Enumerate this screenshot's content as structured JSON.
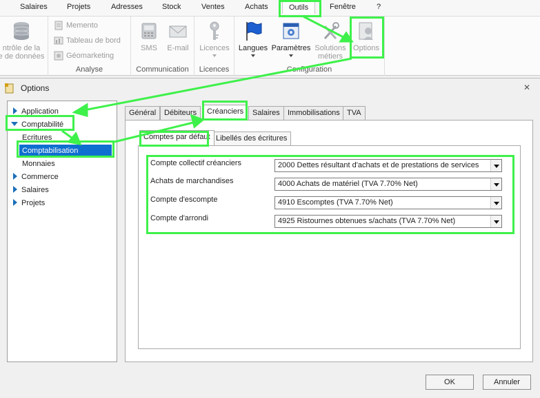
{
  "menubar": {
    "items": [
      "Salaires",
      "Projets",
      "Adresses",
      "Stock",
      "Ventes",
      "Achats",
      "Outils",
      "Fenêtre",
      "?"
    ]
  },
  "ribbon": {
    "db_label_line1": "ntrôle de la",
    "db_label_line2": "e de données",
    "analyse": {
      "items": [
        "Memento",
        "Tableau de bord",
        "Géomarketing"
      ],
      "title": "Analyse"
    },
    "communication": {
      "sms": "SMS",
      "email": "E-mail",
      "title": "Communication"
    },
    "licences": {
      "button": "Licences",
      "title": "Licences"
    },
    "configuration": {
      "langues": "Langues",
      "parametres": "Paramètres",
      "solutions_line1": "Solutions",
      "solutions_line2": "métiers",
      "options": "Options",
      "title": "Configuration"
    }
  },
  "dialog": {
    "title": "Options",
    "close_glyph": "✕",
    "tree": [
      {
        "label": "Application",
        "arrow": "right"
      },
      {
        "label": "Comptabilité",
        "arrow": "down"
      },
      {
        "label": "Ecritures",
        "arrow": "none"
      },
      {
        "label": "Comptabilisation",
        "arrow": "none",
        "selected": true
      },
      {
        "label": "Monnaies",
        "arrow": "none"
      },
      {
        "label": "Commerce",
        "arrow": "right"
      },
      {
        "label": "Salaires",
        "arrow": "right"
      },
      {
        "label": "Projets",
        "arrow": "right"
      }
    ],
    "tabs": [
      "Général",
      "Débiteurs",
      "Créanciers",
      "Salaires",
      "Immobilisations",
      "TVA"
    ],
    "active_tab": "Créanciers",
    "subtabs": [
      "Comptes par défaut",
      "Libellés des écritures"
    ],
    "fields": [
      {
        "label": "Compte collectif créanciers",
        "value": "2000 Dettes résultant d'achats et de prestations de services"
      },
      {
        "label": "Achats de marchandises",
        "value": "4000 Achats de matériel (TVA 7.70% Net)"
      },
      {
        "label": "Compte d'escompte",
        "value": "4910 Escomptes (TVA 7.70% Net)"
      },
      {
        "label": "Compte d'arrondi",
        "value": "4925 Ristournes obtenues s/achats (TVA 7.70% Net)"
      }
    ],
    "ok": "OK",
    "cancel": "Annuler"
  },
  "colors": {
    "highlight": "#3ef14a",
    "selection": "#0f6fd0",
    "tree_arrow": "#1c6fb8"
  }
}
